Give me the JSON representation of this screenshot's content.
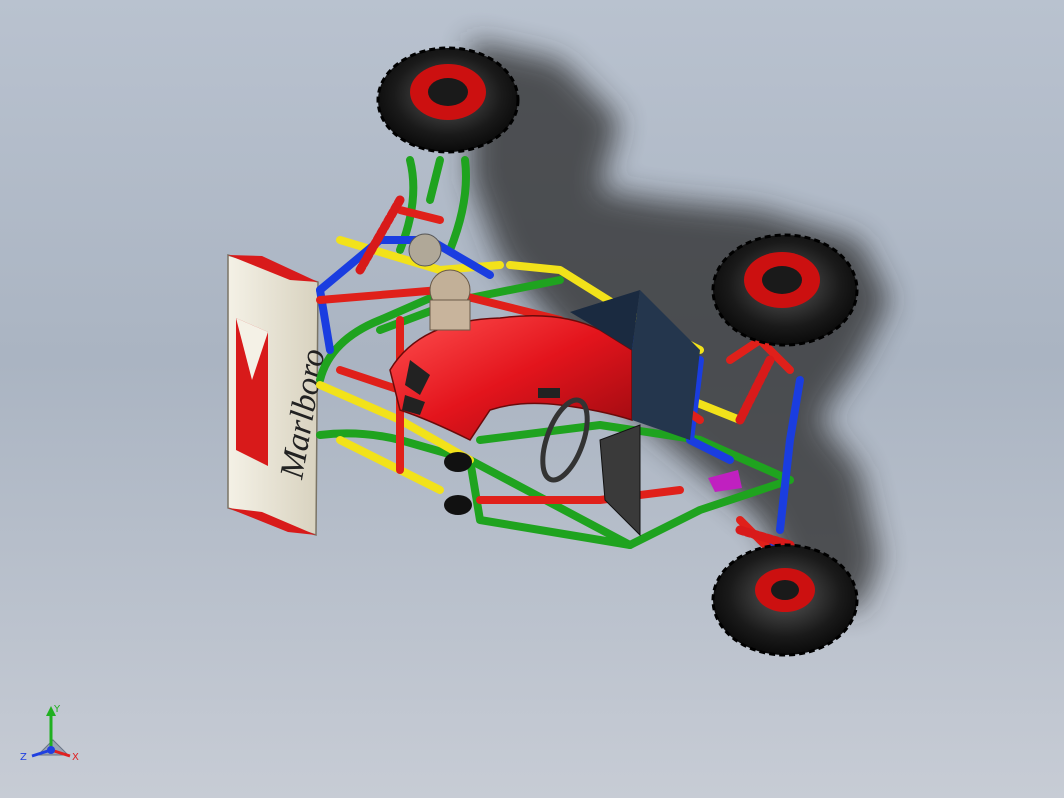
{
  "viewport": {
    "background_top": "#b9c2cf",
    "background_bottom": "#c7ccd5"
  },
  "model": {
    "wing_brand_text": "Marlboro",
    "frame_colors": {
      "green": "#1fa31f",
      "yellow": "#f2e21a",
      "blue": "#1a3de0",
      "red": "#e0201a"
    },
    "body_color": "#e3141c",
    "tire_color": "#1a1a1a",
    "wing_color": "#ece8da"
  },
  "triad": {
    "x_label": "X",
    "y_label": "Y",
    "z_label": "Z",
    "x_color": "#e02020",
    "y_color": "#20b020",
    "z_color": "#2040e0"
  }
}
